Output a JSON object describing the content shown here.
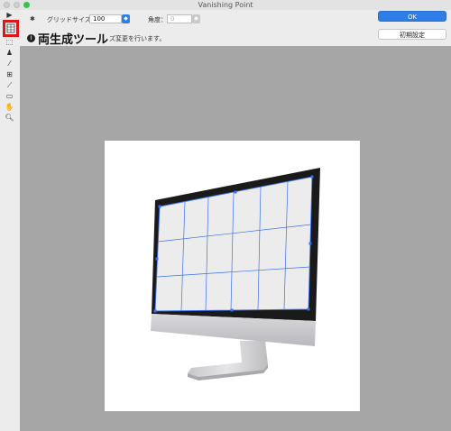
{
  "window": {
    "title": "Vanishing Point"
  },
  "options": {
    "grid_size_label": "グリッドサイズ：",
    "grid_size_value": "100",
    "angle_label": "角度：",
    "angle_value": "0"
  },
  "buttons": {
    "ok": "OK",
    "reset": "初期設定"
  },
  "tooltip": {
    "icon": "i",
    "title": "両生成ツール",
    "desc": "ズ変更を行います。"
  },
  "tools": [
    {
      "name": "edit-plane-tool",
      "icon": "arrow-icon"
    },
    {
      "name": "create-plane-tool",
      "icon": "grid-icon"
    },
    {
      "name": "marquee-tool",
      "icon": "marquee-icon"
    },
    {
      "name": "stamp-tool",
      "icon": "stamp-icon"
    },
    {
      "name": "brush-tool",
      "icon": "brush-icon"
    },
    {
      "name": "transform-tool",
      "icon": "transform-icon"
    },
    {
      "name": "eyedropper-tool",
      "icon": "eyedropper-icon"
    },
    {
      "name": "measure-tool",
      "icon": "ruler-icon"
    },
    {
      "name": "hand-tool",
      "icon": "hand-icon"
    },
    {
      "name": "zoom-tool",
      "icon": "zoom-icon"
    }
  ],
  "colors": {
    "accent": "#2f7de6",
    "selection": "#e0161a",
    "grid": "#3a6ff0"
  }
}
